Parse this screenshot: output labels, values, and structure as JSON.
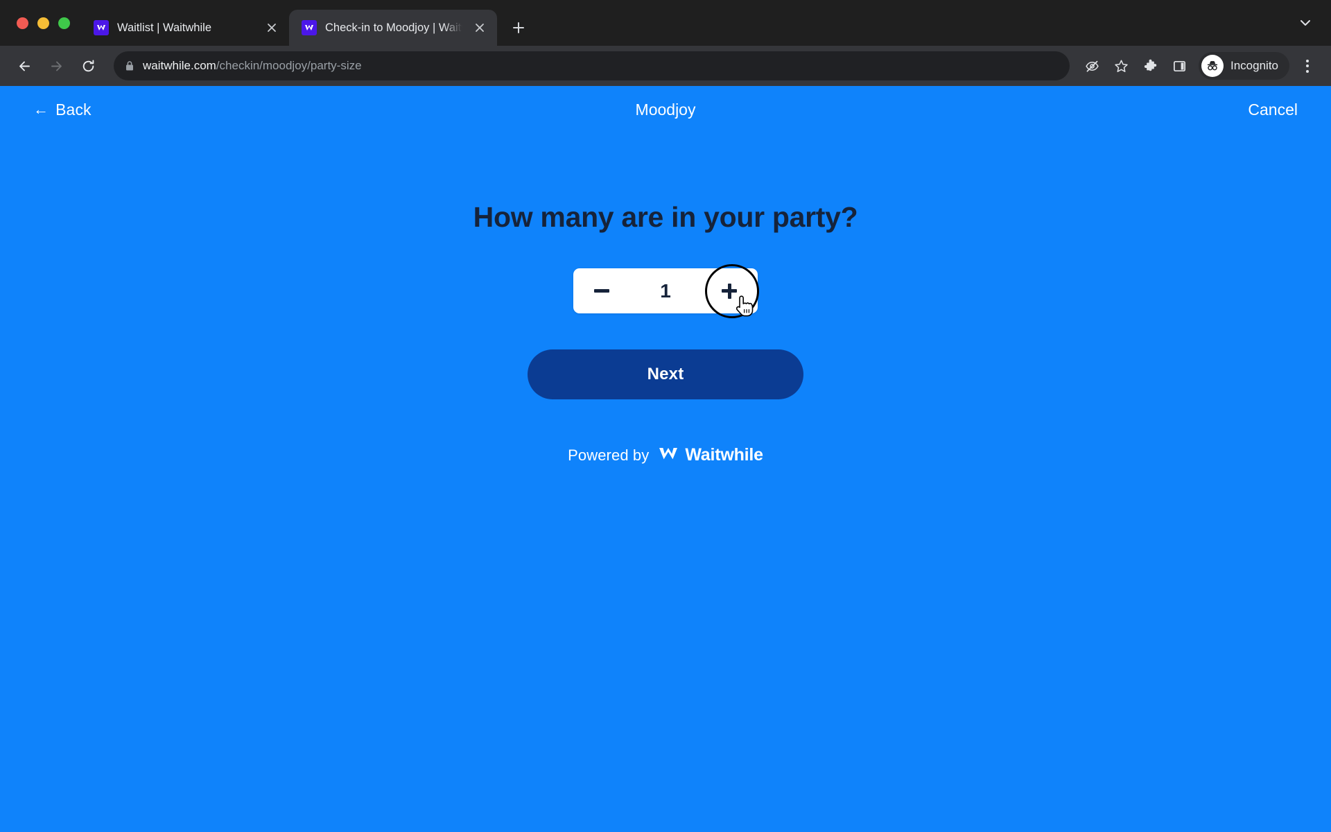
{
  "browser": {
    "window_controls": [
      {
        "name": "close",
        "color": "#f25b53"
      },
      {
        "name": "minimize",
        "color": "#f5bd36"
      },
      {
        "name": "maximize",
        "color": "#3fc84a"
      }
    ],
    "tabs": [
      {
        "title": "Waitlist | Waitwhile",
        "active": false,
        "favicon": "waitwhile-favicon"
      },
      {
        "title": "Check-in to Moodjoy | Waitwhil",
        "active": true,
        "favicon": "waitwhile-favicon"
      }
    ],
    "new_tab_label": "+",
    "tab_list_chevron": "chevron-down-icon",
    "toolbar": {
      "back": "back-arrow-icon",
      "forward": "forward-arrow-icon",
      "reload": "reload-icon",
      "lock": "lock-icon",
      "url_domain": "waitwhile.com",
      "url_path": "/checkin/moodjoy/party-size",
      "icons": [
        "eye-slash-icon",
        "star-icon",
        "extensions-puzzle-icon",
        "side-panel-icon"
      ],
      "profile_label": "Incognito",
      "profile_avatar": "incognito-avatar-icon",
      "menu": "three-dot-menu-icon"
    }
  },
  "page": {
    "header": {
      "back_label": "Back",
      "back_arrow": "←",
      "title": "Moodjoy",
      "cancel_label": "Cancel"
    },
    "question": "How many are in your party?",
    "stepper": {
      "decrement_label": "−",
      "increment_label": "+",
      "value": "1"
    },
    "next_label": "Next",
    "footer": {
      "powered_by": "Powered by",
      "brand": "Waitwhile",
      "brand_mark": "waitwhile-logo-icon"
    },
    "colors": {
      "background": "#0f83fb",
      "heading": "#16233a",
      "next_button": "#0b3c93",
      "stepper_background": "#ffffff",
      "favicon": "#4b17e8"
    }
  }
}
